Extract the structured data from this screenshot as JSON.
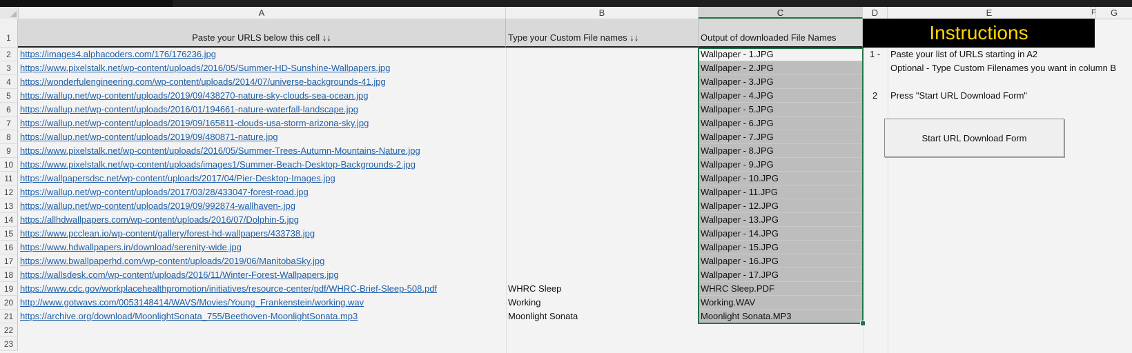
{
  "columns": [
    "A",
    "B",
    "C",
    "D",
    "E",
    "F",
    "G"
  ],
  "row_numbers": [
    "1",
    "2",
    "3",
    "4",
    "5",
    "6",
    "7",
    "8",
    "9",
    "10",
    "11",
    "12",
    "13",
    "14",
    "15",
    "16",
    "17",
    "18",
    "19",
    "20",
    "21",
    "22",
    "23"
  ],
  "headers": {
    "a": "Paste your URLS below this cell ↓↓",
    "b": "Type your Custom File names ↓↓",
    "c": "Output of downloaded File Names"
  },
  "instructions": {
    "title": "Instructions",
    "step1_num": "1 -",
    "step1_text": "Paste your list of URLS starting in A2",
    "step1_optional": "Optional - Type Custom Filenames you want in column B",
    "step2_num": "2",
    "step2_text": "Press \"Start URL Download Form\"",
    "button_label": "Start URL Download Form"
  },
  "rows": [
    {
      "url": "https://images4.alphacoders.com/176/176236.jpg",
      "custom": "",
      "output": "Wallpaper - 1.JPG"
    },
    {
      "url": "https://www.pixelstalk.net/wp-content/uploads/2016/05/Summer-HD-Sunshine-Wallpapers.jpg",
      "custom": "",
      "output": "Wallpaper - 2.JPG"
    },
    {
      "url": "https://wonderfulengineering.com/wp-content/uploads/2014/07/universe-backgrounds-41.jpg",
      "custom": "",
      "output": "Wallpaper - 3.JPG"
    },
    {
      "url": "https://wallup.net/wp-content/uploads/2019/09/438270-nature-sky-clouds-sea-ocean.jpg",
      "custom": "",
      "output": "Wallpaper - 4.JPG"
    },
    {
      "url": "https://wallup.net/wp-content/uploads/2016/01/194661-nature-waterfall-landscape.jpg",
      "custom": "",
      "output": "Wallpaper - 5.JPG"
    },
    {
      "url": "https://wallup.net/wp-content/uploads/2019/09/165811-clouds-usa-storm-arizona-sky.jpg",
      "custom": "",
      "output": "Wallpaper - 6.JPG"
    },
    {
      "url": "https://wallup.net/wp-content/uploads/2019/09/480871-nature.jpg",
      "custom": "",
      "output": "Wallpaper - 7.JPG"
    },
    {
      "url": "https://www.pixelstalk.net/wp-content/uploads/2016/05/Summer-Trees-Autumn-Mountains-Nature.jpg",
      "custom": "",
      "output": "Wallpaper - 8.JPG"
    },
    {
      "url": "https://www.pixelstalk.net/wp-content/uploads/images1/Summer-Beach-Desktop-Backgrounds-2.jpg",
      "custom": "",
      "output": "Wallpaper - 9.JPG"
    },
    {
      "url": "https://wallpapersdsc.net/wp-content/uploads/2017/04/Pier-Desktop-Images.jpg",
      "custom": "",
      "output": "Wallpaper - 10.JPG"
    },
    {
      "url": "https://wallup.net/wp-content/uploads/2017/03/28/433047-forest-road.jpg",
      "custom": "",
      "output": "Wallpaper - 11.JPG"
    },
    {
      "url": "https://wallup.net/wp-content/uploads/2019/09/992874-wallhaven-.jpg",
      "custom": "",
      "output": "Wallpaper - 12.JPG"
    },
    {
      "url": "https://allhdwallpapers.com/wp-content/uploads/2016/07/Dolphin-5.jpg",
      "custom": "",
      "output": "Wallpaper - 13.JPG"
    },
    {
      "url": "https://www.pcclean.io/wp-content/gallery/forest-hd-wallpapers/433738.jpg",
      "custom": "",
      "output": "Wallpaper - 14.JPG"
    },
    {
      "url": "https://www.hdwallpapers.in/download/serenity-wide.jpg",
      "custom": "",
      "output": "Wallpaper - 15.JPG"
    },
    {
      "url": "https://www.bwallpaperhd.com/wp-content/uploads/2019/06/ManitobaSky.jpg",
      "custom": "",
      "output": "Wallpaper - 16.JPG"
    },
    {
      "url": "https://wallsdesk.com/wp-content/uploads/2016/11/Winter-Forest-Wallpapers.jpg",
      "custom": "",
      "output": "Wallpaper - 17.JPG"
    },
    {
      "url": "https://www.cdc.gov/workplacehealthpromotion/initiatives/resource-center/pdf/WHRC-Brief-Sleep-508.pdf",
      "custom": "WHRC Sleep",
      "output": "WHRC Sleep.PDF"
    },
    {
      "url": "http://www.gotwavs.com/0053148414/WAVS/Movies/Young_Frankenstein/working.wav",
      "custom": "Working",
      "output": "Working.WAV"
    },
    {
      "url": "https://archive.org/download/MoonlightSonata_755/Beethoven-MoonlightSonata.mp3",
      "custom": "Moonlight Sonata",
      "output": "Moonlight Sonata.MP3"
    }
  ],
  "colors": {
    "link": "#1f5fa8",
    "selection": "#217346",
    "instructions_bg": "#000000",
    "instructions_fg": "#ffd800",
    "output_fill": "#bdbdbd"
  }
}
